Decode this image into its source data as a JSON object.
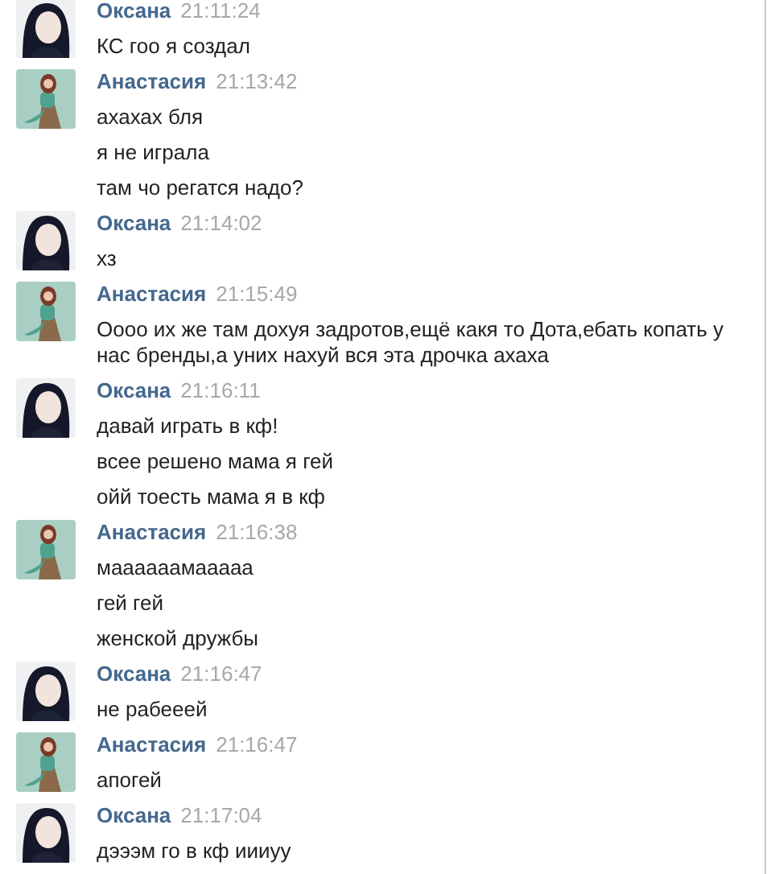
{
  "messages": [
    {
      "sender": "Оксана",
      "time": "21:11:24",
      "lines": [
        "КС гоо я создал"
      ]
    },
    {
      "sender": "Анастасия",
      "time": "21:13:42",
      "lines": [
        "ахахах бля",
        "я не играла",
        "там чо регатся надо?"
      ]
    },
    {
      "sender": "Оксана",
      "time": "21:14:02",
      "lines": [
        "хз"
      ]
    },
    {
      "sender": "Анастасия",
      "time": "21:15:49",
      "lines": [
        "Оооо их же там дохуя задротов,ещё какя то Дота,ебать копать у нас бренды,а уних нахуй вся эта дрочка ахаха"
      ]
    },
    {
      "sender": "Оксана",
      "time": "21:16:11",
      "lines": [
        "давай играть в кф!",
        "всее решено мама я гей",
        "ойй тоесть мама я в кф"
      ]
    },
    {
      "sender": "Анастасия",
      "time": "21:16:38",
      "lines": [
        "маааааамааааа",
        "гей гей",
        "женской дружбы"
      ]
    },
    {
      "sender": "Оксана",
      "time": "21:16:47",
      "lines": [
        "не рабееей"
      ]
    },
    {
      "sender": "Анастасия",
      "time": "21:16:47",
      "lines": [
        "апогей"
      ]
    },
    {
      "sender": "Оксана",
      "time": "21:17:04",
      "lines": [
        "дэээм го в кф иииуу"
      ]
    }
  ]
}
